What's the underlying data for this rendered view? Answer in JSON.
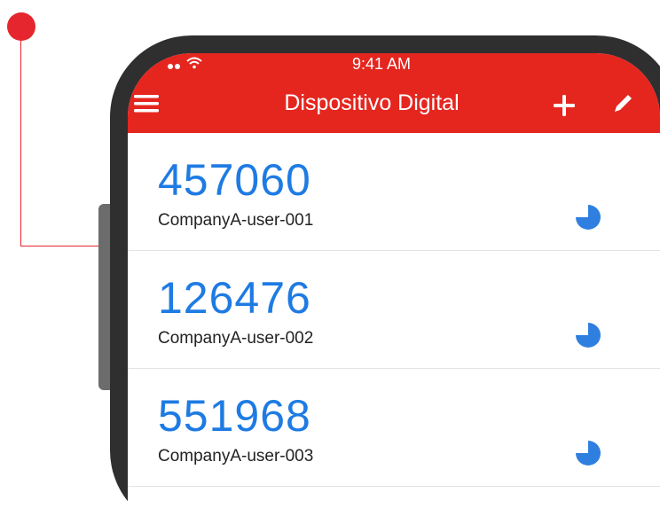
{
  "status_bar": {
    "time": "9:41 AM"
  },
  "app_bar": {
    "title": "Dispositivo Digital"
  },
  "accounts": [
    {
      "code": "457060",
      "name": "CompanyA-user-001",
      "timer_remaining": 0.75
    },
    {
      "code": "126476",
      "name": "CompanyA-user-002",
      "timer_remaining": 0.75
    },
    {
      "code": "551968",
      "name": "CompanyA-user-003",
      "timer_remaining": 0.75
    }
  ],
  "colors": {
    "app_bar": "#e4261f",
    "code_text": "#1e7be3",
    "timer": "#2f7fe0",
    "callout": "#e5262e",
    "phone_frame": "#2f2f2f"
  },
  "icons": [
    "menu-icon",
    "add-icon",
    "edit-icon",
    "timer-icon",
    "wifi-icon",
    "signal-icon"
  ]
}
